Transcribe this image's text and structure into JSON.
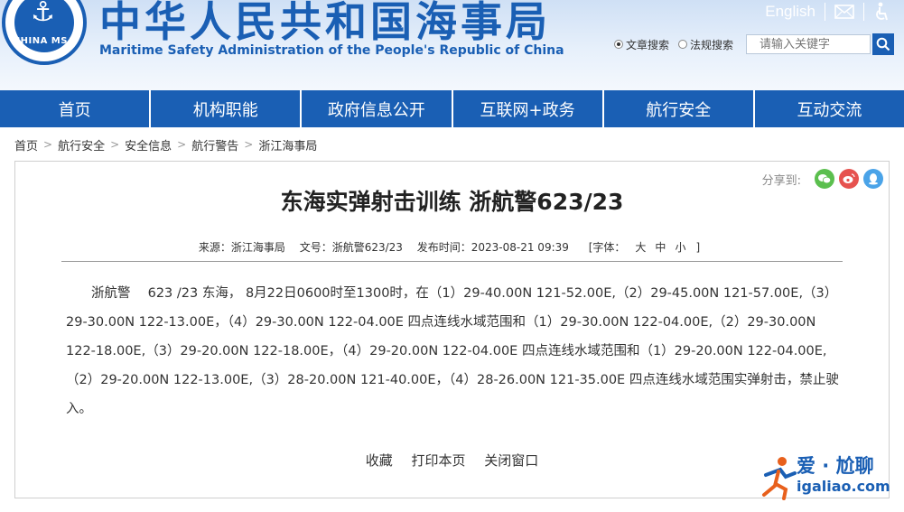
{
  "header": {
    "emblem_text": "CHINA MSA",
    "site_title": "中华人民共和国海事局",
    "site_subtitle": "Maritime Safety Administration of the People's Republic of China",
    "english_link": "English",
    "mail_icon": "mail-icon",
    "accessibility_icon": "accessibility-icon",
    "search": {
      "radio_article": "文章搜索",
      "radio_regulation": "法规搜索",
      "selected": "文章搜索",
      "placeholder": "请输入关键字",
      "button_icon": "search-icon"
    }
  },
  "nav": {
    "items": [
      "首页",
      "机构职能",
      "政府信息公开",
      "互联网+政务",
      "航行安全",
      "互动交流"
    ]
  },
  "breadcrumb": [
    "首页",
    "航行安全",
    "安全信息",
    "航行警告",
    "浙江海事局"
  ],
  "article": {
    "share_label": "分享到:",
    "share_icons": [
      "wechat-icon",
      "weibo-icon",
      "qq-icon"
    ],
    "title": "东海实弹射击训练 浙航警623/23",
    "meta": {
      "source": "来源：浙江海事局",
      "doc_no": "文号：浙航警623/23",
      "published": "发布时间：2023-08-21 09:39",
      "font_label": "[字体：",
      "font_large": "大",
      "font_medium": "中",
      "font_small": "小",
      "font_close": "]"
    },
    "body": "浙航警　 623 /23 东海， 8月22日0600时至1300时，在（1）29-40.00N 121-52.00E,（2）29-45.00N 121-57.00E,（3）29-30.00N 122-13.00E，（4）29-30.00N 122-04.00E 四点连线水域范围和（1）29-30.00N 122-04.00E,（2）29-30.00N 122-18.00E,（3）29-20.00N 122-18.00E，（4）29-20.00N 122-04.00E 四点连线水域范围和（1）29-20.00N 122-04.00E,（2）29-20.00N 122-13.00E,（3）28-20.00N 121-40.00E，（4）28-26.00N 121-35.00E 四点连线水域范围实弹射击，禁止驶入。",
    "actions": [
      "收藏",
      "打印本页",
      "关闭窗口"
    ]
  },
  "watermark": {
    "top": "爱 · 尬聊",
    "bottom": "igaliao.com"
  },
  "colors": {
    "brand_blue": "#1a5fb4",
    "wechat": "#5bbf4e",
    "weibo": "#e6524f",
    "qq": "#4aa3e8"
  }
}
